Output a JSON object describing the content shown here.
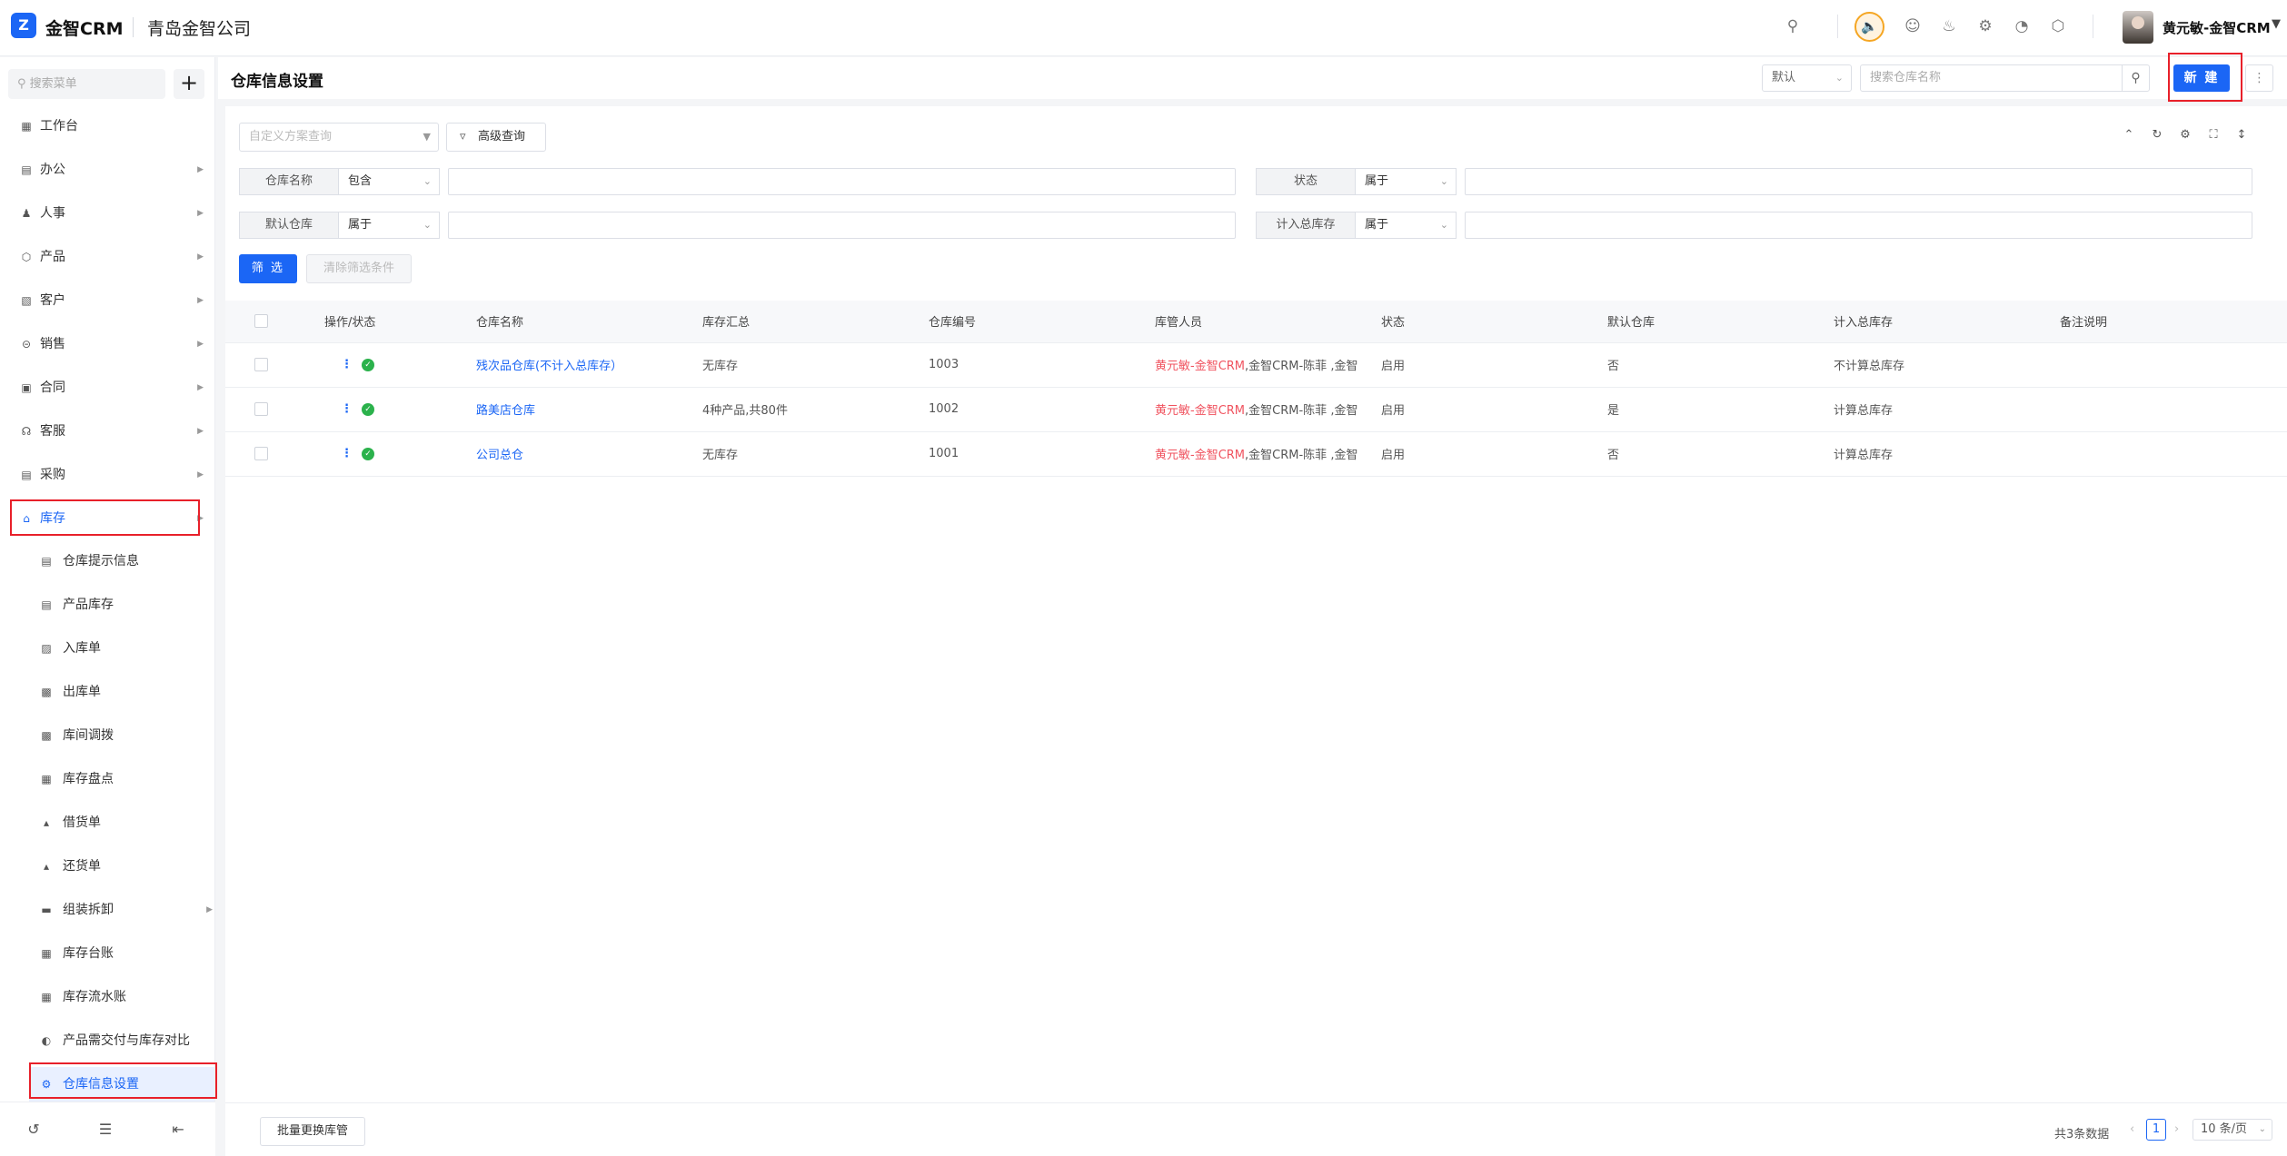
{
  "app": {
    "logo_text": "金智CRM",
    "company": "青岛金智公司",
    "user_name": "黄元敏-金智CRM"
  },
  "sidebar": {
    "search_placeholder": "搜索菜单",
    "menu": [
      {
        "label": "工作台",
        "icon": "dashboard-icon",
        "has_children": false
      },
      {
        "label": "办公",
        "icon": "office-icon",
        "has_children": true
      },
      {
        "label": "人事",
        "icon": "people-icon",
        "has_children": true
      },
      {
        "label": "产品",
        "icon": "product-icon",
        "has_children": true
      },
      {
        "label": "客户",
        "icon": "customer-icon",
        "has_children": true
      },
      {
        "label": "销售",
        "icon": "sales-icon",
        "has_children": true
      },
      {
        "label": "合同",
        "icon": "contract-icon",
        "has_children": true
      },
      {
        "label": "客服",
        "icon": "service-icon",
        "has_children": true
      },
      {
        "label": "采购",
        "icon": "purchase-icon",
        "has_children": true
      },
      {
        "label": "库存",
        "icon": "warehouse-icon",
        "has_children": true,
        "active": true
      }
    ],
    "submenu": [
      {
        "label": "仓库提示信息",
        "icon": "info-icon"
      },
      {
        "label": "产品库存",
        "icon": "file-icon"
      },
      {
        "label": "入库单",
        "icon": "inbound-icon"
      },
      {
        "label": "出库单",
        "icon": "outbound-icon"
      },
      {
        "label": "库间调拨",
        "icon": "transfer-icon"
      },
      {
        "label": "库存盘点",
        "icon": "inventory-check-icon"
      },
      {
        "label": "借货单",
        "icon": "borrow-icon"
      },
      {
        "label": "还货单",
        "icon": "return-icon"
      },
      {
        "label": "组装拆卸",
        "icon": "folder-icon",
        "has_children": true
      },
      {
        "label": "库存台账",
        "icon": "ledger-icon"
      },
      {
        "label": "库存流水账",
        "icon": "journal-icon"
      },
      {
        "label": "产品需交付与库存对比",
        "icon": "compare-icon"
      },
      {
        "label": "仓库信息设置",
        "icon": "settings-icon",
        "active": true
      }
    ]
  },
  "page": {
    "title": "仓库信息设置",
    "view_select": "默认",
    "search_placeholder": "搜索仓库名称",
    "new_button": "新 建"
  },
  "filters": {
    "scheme_placeholder": "自定义方案查询",
    "advanced_label": "高级查询",
    "rows": [
      {
        "label": "仓库名称",
        "operator": "包含"
      },
      {
        "label": "状态",
        "operator": "属于"
      },
      {
        "label": "默认仓库",
        "operator": "属于"
      },
      {
        "label": "计入总库存",
        "operator": "属于"
      }
    ],
    "filter_button": "筛 选",
    "clear_button": "清除筛选条件"
  },
  "table": {
    "columns": [
      "操作/状态",
      "仓库名称",
      "库存汇总",
      "仓库编号",
      "库管人员",
      "状态",
      "默认仓库",
      "计入总库存",
      "备注说明"
    ],
    "rows": [
      {
        "name": "残次品仓库(不计入总库存）",
        "summary": "无库存",
        "code": "1003",
        "manager_main": "黄元敏-金智CRM",
        "manager_rest": ",金智CRM-陈菲 ,金智",
        "status": "启用",
        "is_default": "否",
        "count_total": "不计算总库存",
        "remark": ""
      },
      {
        "name": "路美店仓库",
        "summary": "4种产品,共80件",
        "code": "1002",
        "manager_main": "黄元敏-金智CRM",
        "manager_rest": ",金智CRM-陈菲 ,金智",
        "status": "启用",
        "is_default": "是",
        "count_total": "计算总库存",
        "remark": ""
      },
      {
        "name": "公司总仓",
        "summary": "无库存",
        "code": "1001",
        "manager_main": "黄元敏-金智CRM",
        "manager_rest": ",金智CRM-陈菲 ,金智",
        "status": "启用",
        "is_default": "否",
        "count_total": "计算总库存",
        "remark": ""
      }
    ]
  },
  "footer": {
    "batch_button": "批量更换库管",
    "total": "共3条数据",
    "current_page": "1",
    "page_size": "10 条/页"
  },
  "colors": {
    "accent": "#1b66f5",
    "manager_highlight": "#f0535f",
    "status_ok": "#2bb24c",
    "annotation_box": "#e8202a"
  }
}
